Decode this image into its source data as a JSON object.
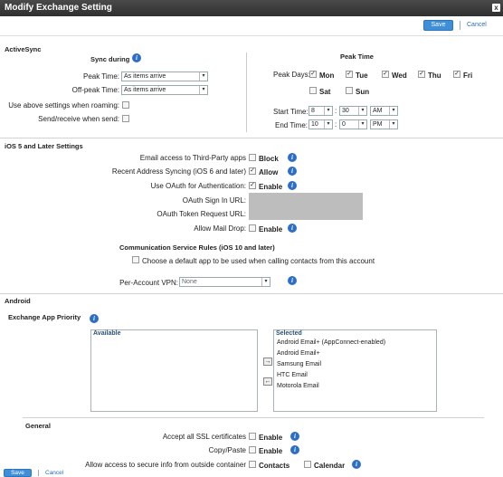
{
  "window": {
    "title": "Modify Exchange Setting",
    "close_glyph": "x"
  },
  "toolbar": {
    "save_label": "Save",
    "cancel_label": "Cancel"
  },
  "activesync": {
    "section_title": "ActiveSync",
    "sync_during_title": "Sync during",
    "peak_time_label": "Peak Time:",
    "peak_time_value": "As items arrive",
    "offpeak_label": "Off-peak Time:",
    "offpeak_value": "As items arrive",
    "roaming_label": "Use above settings when roaming:",
    "sendreceive_label": "Send/receive when send:",
    "peak_panel_title": "Peak Time",
    "peak_days_label": "Peak Days:",
    "days": [
      {
        "label": "Mon",
        "checked": true
      },
      {
        "label": "Tue",
        "checked": true
      },
      {
        "label": "Wed",
        "checked": true
      },
      {
        "label": "Thu",
        "checked": true
      },
      {
        "label": "Fri",
        "checked": true
      },
      {
        "label": "Sat",
        "checked": false
      },
      {
        "label": "Sun",
        "checked": false
      }
    ],
    "start_time_label": "Start Time:",
    "start_hour": "8",
    "start_min": "30",
    "start_ampm": "AM",
    "end_time_label": "End Time:",
    "end_hour": "10",
    "end_min": "0",
    "end_ampm": "PM",
    "time_sep": ":"
  },
  "ios": {
    "section_title": "iOS 5 and Later Settings",
    "email_access_label": "Email access to Third-Party apps",
    "email_access_opt": "Block",
    "recent_addr_label": "Recent Address Syncing (iOS 6 and later)",
    "recent_addr_opt": "Allow",
    "oauth_label": "Use OAuth for Authentication:",
    "oauth_opt": "Enable",
    "oauth_signin_label": "OAuth Sign In URL:",
    "oauth_token_label": "OAuth Token Request URL:",
    "allow_mail_drop_label": "Allow Mail Drop:",
    "allow_mail_drop_opt": "Enable",
    "comm_rules_title": "Communication Service Rules (iOS 10 and later)",
    "comm_rules_opt": "Choose a default app to be used when calling contacts from this account",
    "vpn_label": "Per-Account VPN:",
    "vpn_value": "None"
  },
  "android": {
    "section_title": "Android",
    "priority_label": "Exchange App Priority",
    "available_header": "Available",
    "selected_header": "Selected",
    "selected_items": [
      "Android Email+ (AppConnect-enabled)",
      "Android Email+",
      "Samsung Email",
      "HTC Email",
      "Motorola Email"
    ],
    "move_right_glyph": "→",
    "move_left_glyph": "←"
  },
  "general": {
    "section_title": "General",
    "ssl_label": "Accept all SSL certificates",
    "ssl_opt": "Enable",
    "copypaste_label": "Copy/Paste",
    "copypaste_opt": "Enable",
    "secure_info_label": "Allow access to secure info from outside container",
    "contacts_opt": "Contacts",
    "calendar_opt": "Calendar"
  },
  "footer": {
    "save_label": "Save",
    "cancel_label": "Cancel"
  },
  "icons": {
    "info": "i",
    "dropdown": "▾",
    "check": "✓"
  },
  "colors": {
    "accent": "#3f8ed8",
    "link": "#2a6fb8",
    "info": "#2d6fc4"
  }
}
